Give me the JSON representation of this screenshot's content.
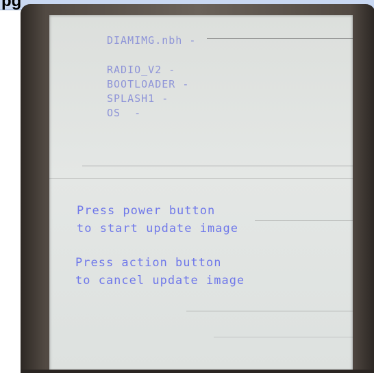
{
  "header": {
    "fragment_text": "pg"
  },
  "screen": {
    "image_name": "DIAMIMG.nbh -",
    "components": [
      "RADIO_V2 -",
      "BOOTLOADER -",
      "SPLASH1 -",
      "OS  -"
    ],
    "power_prompt": [
      "Press power button",
      "to start update image"
    ],
    "action_prompt": [
      "Press action button",
      "to cancel update image"
    ]
  },
  "colors": {
    "info_text": "#8e94d8",
    "prompt_text": "#6f78ea",
    "screen_bg": "#e1e4e2",
    "bezel": "#524a43"
  }
}
